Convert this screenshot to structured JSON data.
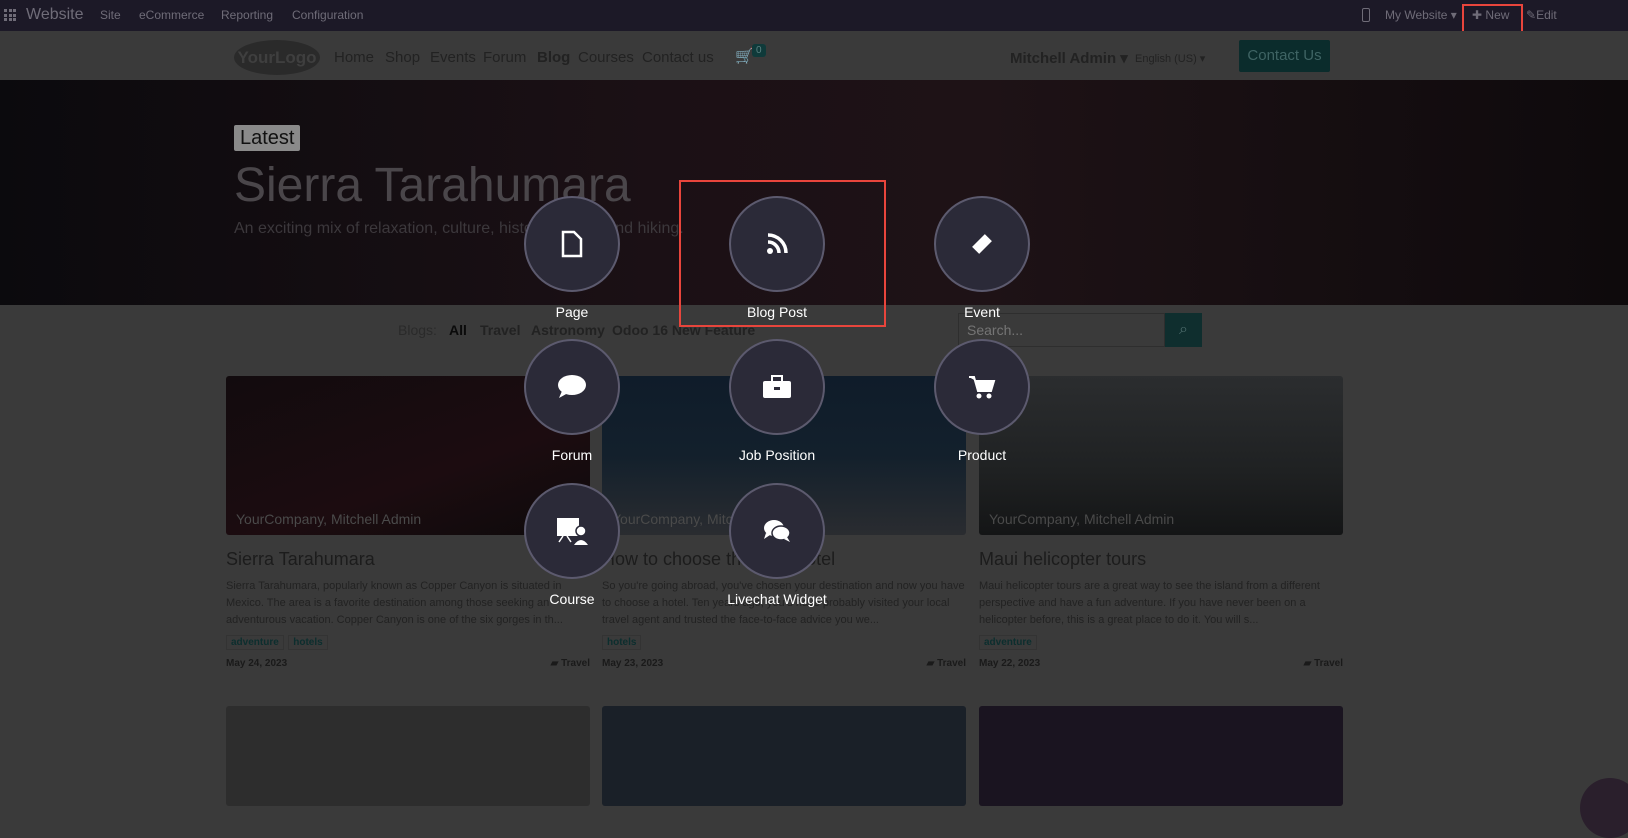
{
  "topbar": {
    "app": "Website",
    "menus": [
      "Site",
      "eCommerce",
      "Reporting",
      "Configuration"
    ],
    "website": "My Website",
    "new": "New",
    "edit": "Edit"
  },
  "nav": {
    "logo": "YourLogo",
    "links": [
      "Home",
      "Shop",
      "Events",
      "Forum",
      "Blog",
      "Courses",
      "Contact us"
    ],
    "cart_count": "0",
    "user": "Mitchell Admin",
    "language": "English (US)",
    "cta": "Contact Us"
  },
  "hero": {
    "badge": "Latest",
    "title": "Sierra Tarahumara",
    "subtitle": "An exciting mix of relaxation, culture, history, wildlife and hiking."
  },
  "filters": {
    "label": "Blogs:",
    "items": [
      "All",
      "Travel",
      "Astronomy",
      "Odoo 16 New Feature"
    ],
    "search_placeholder": "Search..."
  },
  "posts": [
    {
      "author": "YourCompany, Mitchell Admin",
      "title": "Sierra Tarahumara",
      "text": "Sierra Tarahumara, popularly known as Copper Canyon is situated in Mexico. The area is a favorite destination among those seeking an adventurous vacation. Copper Canyon is one of the six gorges in th...",
      "tags": [
        "adventure",
        "hotels"
      ],
      "date": "May 24, 2023",
      "blog": "Travel"
    },
    {
      "author": "YourCompany, Mitchell Admin",
      "title": "How to choose the right hotel",
      "text": "So you're going abroad, you've chosen your destination and now you have to choose a hotel. Ten years ago, you'd have probably visited your local travel agent and trusted the face-to-face advice you we...",
      "tags": [
        "hotels"
      ],
      "date": "May 23, 2023",
      "blog": "Travel"
    },
    {
      "author": "YourCompany, Mitchell Admin",
      "title": "Maui helicopter tours",
      "text": "Maui helicopter tours are a great way to see the island from a different perspective and have a fun adventure. If you have never been on a helicopter before, this is a great place to do it. You will s...",
      "tags": [
        "adventure"
      ],
      "date": "May 22, 2023",
      "blog": "Travel"
    }
  ],
  "new_options": [
    "Page",
    "Blog Post",
    "Event",
    "Forum",
    "Job Position",
    "Product",
    "Course",
    "Livechat Widget"
  ],
  "colors": {
    "highlight": "#e8453c",
    "circle": "#2b2a38"
  }
}
